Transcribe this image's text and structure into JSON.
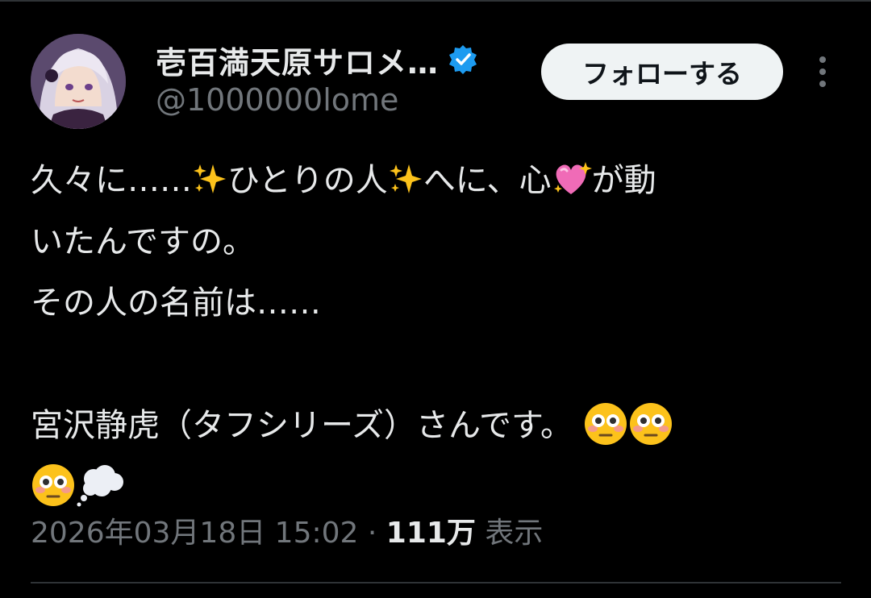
{
  "author": {
    "display_name": "壱百満天原サロメ…",
    "handle": "@1000000lome",
    "verified": true,
    "verified_color": "#1d9bf0"
  },
  "actions": {
    "follow_label": "フォローする",
    "more_icon": "more-vertical-icon"
  },
  "tweet": {
    "line1_a": "久々に……",
    "line1_b": "ひとりの人",
    "line1_c": "へに、心",
    "line1_d": "が動",
    "line2": "いたんですの。",
    "line3": "その人の名前は……",
    "line4": "",
    "line5": "宮沢静虎（タフシリーズ）さんです。",
    "emojis": [
      "sparkles-icon",
      "sparkling-heart-icon",
      "flushed-face-icon",
      "thought-balloon-icon"
    ]
  },
  "meta": {
    "datetime": "2026年03月18日 15:02",
    "separator": " · ",
    "views_count": "111万",
    "views_label": " 表示"
  },
  "colors": {
    "background": "#000000",
    "text": "#e7e9ea",
    "secondary": "#71767b",
    "divider": "#2f3336"
  }
}
